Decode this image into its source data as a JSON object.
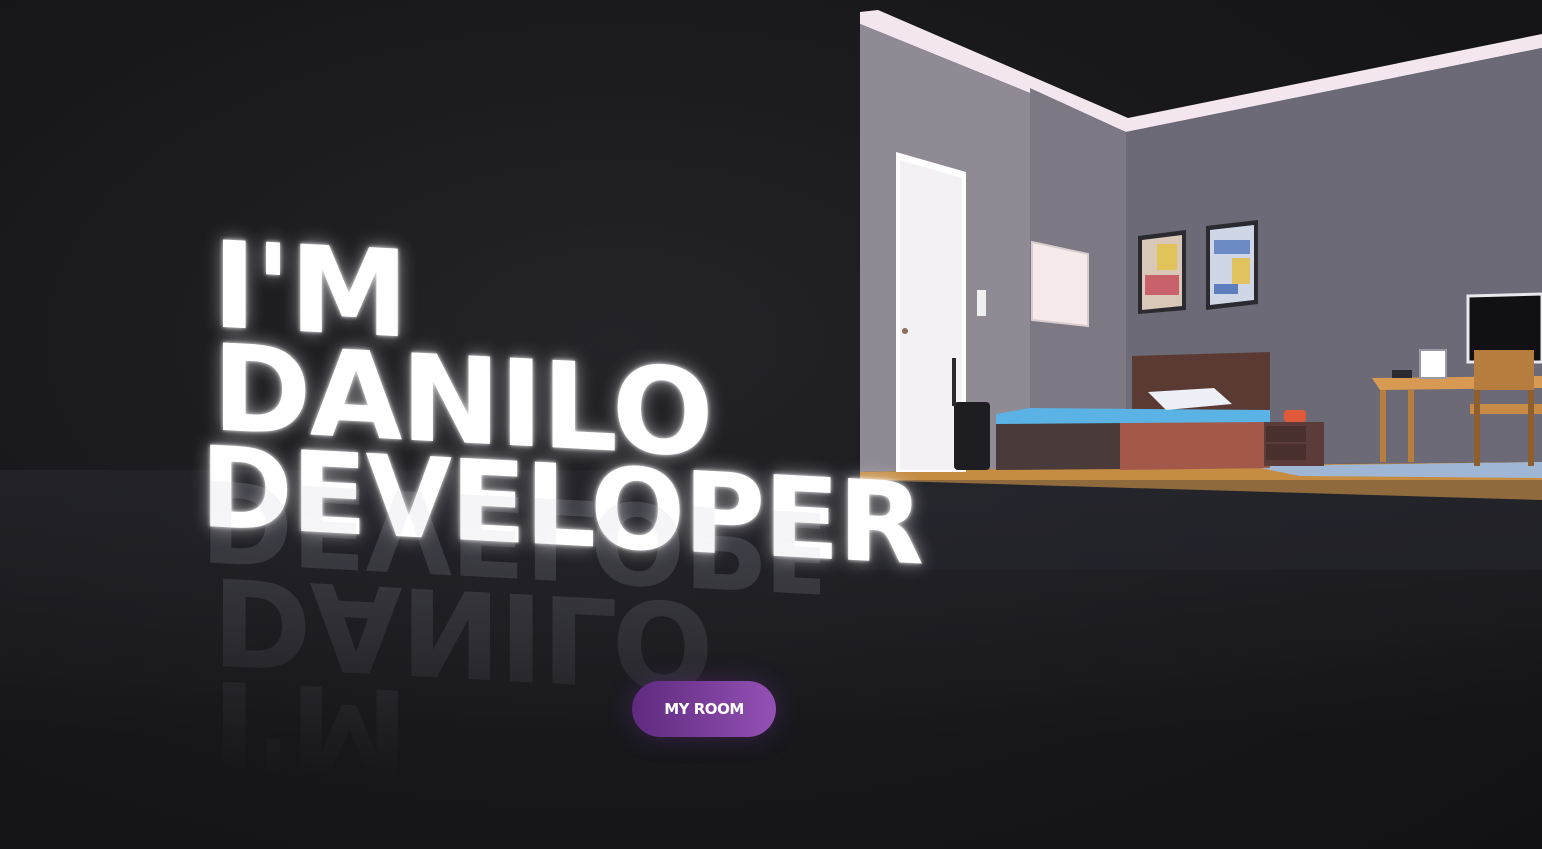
{
  "hero": {
    "line1": "I'M DANILO",
    "line2": "DEVELOPER"
  },
  "cta": {
    "label": "MY ROOM"
  },
  "colors": {
    "background": "#17171b",
    "button_start": "#5e2a7e",
    "button_end": "#9451b5",
    "text": "#ffffff"
  }
}
